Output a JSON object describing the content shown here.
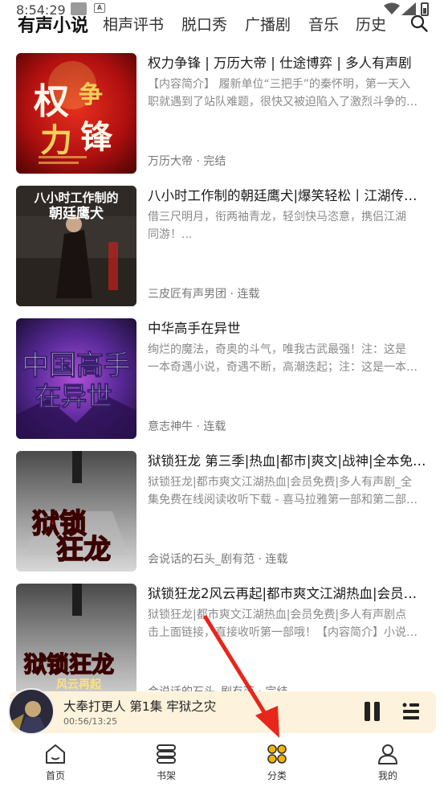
{
  "status": {
    "time": "8:54:29"
  },
  "tabs": [
    "有声小说",
    "相声评书",
    "脱口秀",
    "广播剧",
    "音乐",
    "历史"
  ],
  "items": [
    {
      "title": "权力争锋 | 万历大帝 | 仕途博弈 | 多人有声剧",
      "desc1": "【内容简介】 履新单位“三把手”的秦怀明，第一天入",
      "desc2": "职就遇到了站队难题，很快又被迫陷入了激烈斗争的…",
      "meta": "万历大帝 · 完结",
      "cover_text": [
        "权",
        "争",
        "力",
        "锋"
      ]
    },
    {
      "title": "八小时工作制的朝廷鹰犬|爆笑轻松丨江湖传…",
      "desc1": "借三尺明月，衔两袖青龙，轻剑快马恣意，携侣江湖",
      "desc2": "同游！...",
      "meta": "三皮匠有声男团 · 连载",
      "cover_text": [
        "八小时工作制的",
        "朝廷鹰犬"
      ]
    },
    {
      "title": "中华高手在异世",
      "desc1": "绚烂的魔法，奇奥的斗气，唯我古武最强！注：这是",
      "desc2": "一本奇遇小说，奇遇不断，高潮迭起；注：这是一本…",
      "meta": "意志神牛 · 连载",
      "cover_text": [
        "中国高手",
        "在异世"
      ]
    },
    {
      "title": "狱锁狂龙 第三季|热血|都市|爽文|战神|全本免…",
      "desc1": "狱锁狂龙|都市爽文江湖热血|会员免费|多人有声剧_全",
      "desc2": "集免费在线阅读收听下载 - 喜马拉雅第一部和第二部…",
      "meta": "会说话的石头_剧有范 · 连载",
      "cover_text": [
        "狱锁",
        "狂龙"
      ]
    },
    {
      "title": "狱锁狂龙2风云再起|都市爽文江湖热血|会员…",
      "desc1": "狱锁狂龙|都市爽文江湖热血|会员免费|多人有声剧点",
      "desc2": "击上面链接，直接收听第一部哦！【内容简介】小说…",
      "meta": "会说话的石头_剧有范 · 完结",
      "cover_text": [
        "狱锁狂龙",
        "风云再起"
      ]
    }
  ],
  "player": {
    "title": "大奉打更人 第1集 牢狱之灾",
    "time": "00:56/13:25"
  },
  "bottom_nav": [
    "首页",
    "书架",
    "分类",
    "我的"
  ],
  "colors": {
    "accent": "#f4b400",
    "player_bg": "#fdf3dc",
    "arrow": "#e8261c"
  }
}
